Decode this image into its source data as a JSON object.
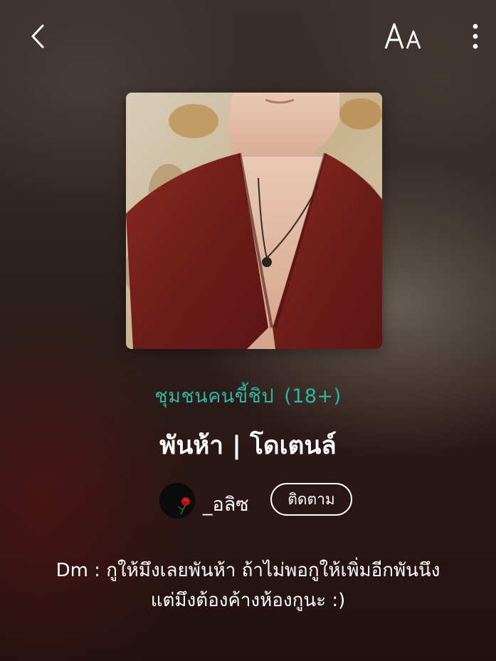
{
  "toolbar": {
    "back_icon": "chevron-left-icon",
    "font_size_label": "AA",
    "font_size_icon": "text-size-icon",
    "more_icon": "more-vertical-icon"
  },
  "story": {
    "community": "ชุมชนคนขี้ชิป",
    "rating": "(18+)",
    "title": "พันห้า | โดเตนล์",
    "author": {
      "name": "_อลิซ",
      "avatar_icon": "rose-avatar"
    },
    "follow_label": "ติดตาม",
    "description_lines": [
      "Dm : กูให้มึงเลยพันห้า ถ้าไม่พอกูให้เพิ่มอีกพันนึง",
      "แต่มึงต้องค้างห้องกูนะ :)"
    ]
  },
  "colors": {
    "accent": "#2fb59c",
    "background": "#2a201d",
    "text": "#ffffff"
  }
}
